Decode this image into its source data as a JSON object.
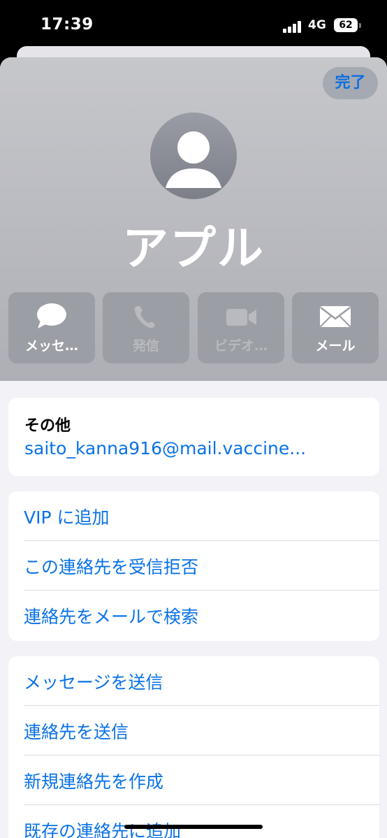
{
  "status_bar": {
    "time": "17:39",
    "network": "4G",
    "battery": "62"
  },
  "header": {
    "done_label": "完了",
    "contact_name": "アプル",
    "actions": [
      {
        "label": "メッセ…",
        "icon": "message-bubble-icon",
        "enabled": true
      },
      {
        "label": "発信",
        "icon": "phone-icon",
        "enabled": false
      },
      {
        "label": "ビデオ…",
        "icon": "video-camera-icon",
        "enabled": false
      },
      {
        "label": "メール",
        "icon": "envelope-icon",
        "enabled": true
      }
    ]
  },
  "other_card": {
    "label": "その他",
    "value": "saito_kanna916@mail.vaccine..."
  },
  "group1": [
    {
      "label": "VIP に追加"
    },
    {
      "label": "この連絡先を受信拒否"
    },
    {
      "label": "連絡先をメールで検索"
    }
  ],
  "group2": [
    {
      "label": "メッセージを送信"
    },
    {
      "label": "連絡先を送信"
    },
    {
      "label": "新規連絡先を作成"
    },
    {
      "label": "既存の連絡先に追加"
    }
  ],
  "colors": {
    "accent": "#0a72e6",
    "header_gradient_top": "#c6c7cb",
    "header_gradient_bottom": "#aeafb6",
    "page_bg": "#f2f2f7"
  }
}
